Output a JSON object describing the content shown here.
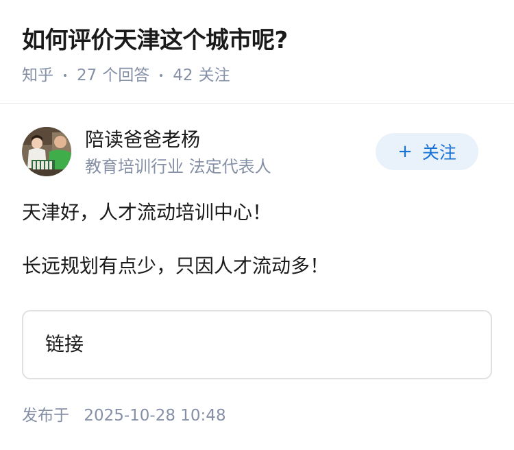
{
  "question": {
    "title": "如何评价天津这个城市呢?",
    "source": "知乎",
    "answer_count": "27",
    "answer_label": "个回答",
    "follower_count": "42",
    "follower_label": "关注"
  },
  "author": {
    "name": "陪读爸爸老杨",
    "headline": "教育培训行业 法定代表人",
    "avatar_icon": "user-photo",
    "follow_plus": "+",
    "follow_label": "关注"
  },
  "answer": {
    "lines": [
      "天津好，人才流动培训中心！",
      "长远规划有点少，只因人才流动多！"
    ],
    "link_card_label": "链接"
  },
  "publish": {
    "prefix": "发布于",
    "datetime": "2025-10-28 10:48"
  },
  "colors": {
    "title": "#1a1a1a",
    "meta_gray": "#8590a6",
    "accent_blue": "#1772d6",
    "follow_bg": "#e9f2fb",
    "divider": "#ebebeb"
  }
}
